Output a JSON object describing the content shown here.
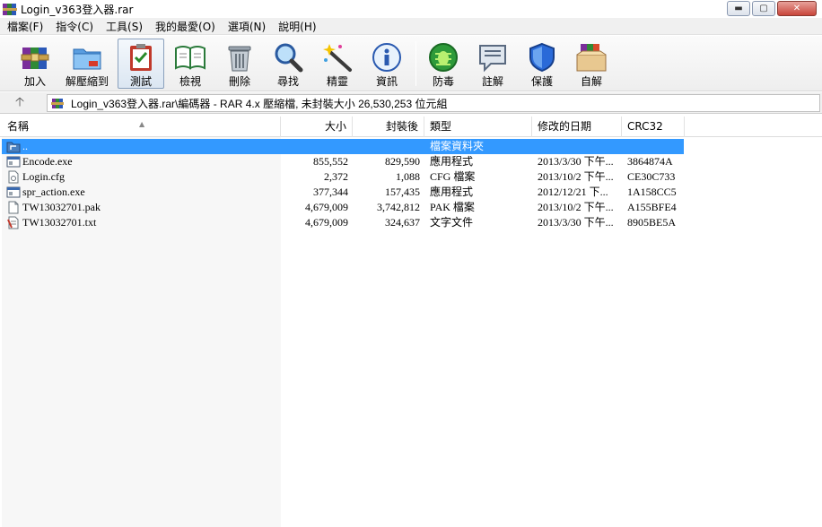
{
  "window": {
    "title": "Login_v363登入器.rar",
    "min_glyph": "▬",
    "max_glyph": "▢",
    "close_glyph": "✕"
  },
  "menu": [
    {
      "label": "檔案(F)"
    },
    {
      "label": "指令(C)"
    },
    {
      "label": "工具(S)"
    },
    {
      "label": "我的最愛(O)"
    },
    {
      "label": "選項(N)"
    },
    {
      "label": "說明(H)"
    }
  ],
  "toolbar": {
    "buttons": [
      {
        "label": "加入",
        "icon": "add-archive-icon"
      },
      {
        "label": "解壓縮到",
        "icon": "extract-folder-icon"
      },
      {
        "label": "測試",
        "icon": "test-clipboard-icon"
      },
      {
        "label": "檢視",
        "icon": "view-book-icon"
      },
      {
        "label": "刪除",
        "icon": "trash-icon"
      },
      {
        "label": "尋找",
        "icon": "magnifier-icon"
      },
      {
        "label": "精靈",
        "icon": "wizard-wand-icon"
      },
      {
        "label": "資訊",
        "icon": "info-icon"
      },
      {
        "label": "防毒",
        "icon": "antivirus-bug-icon"
      },
      {
        "label": "註解",
        "icon": "comment-icon"
      },
      {
        "label": "保護",
        "icon": "shield-icon"
      },
      {
        "label": "自解",
        "icon": "sfx-box-icon"
      }
    ]
  },
  "address": {
    "path": "Login_v363登入器.rar\\編碼器 - RAR 4.x 壓縮檔, 未封裝大小 26,530,253 位元組"
  },
  "columns": {
    "name": "名稱",
    "size": "大小",
    "packed": "封裝後",
    "type": "類型",
    "modified": "修改的日期",
    "crc": "CRC32"
  },
  "files": [
    {
      "name": "..",
      "size": "",
      "packed": "",
      "type": "檔案資料夾",
      "modified": "",
      "crc": "",
      "icon": "folder-up-icon",
      "selected": true
    },
    {
      "name": "Encode.exe",
      "size": "855,552",
      "packed": "829,590",
      "type": "應用程式",
      "modified": "2013/3/30 下午...",
      "crc": "3864874A",
      "icon": "exe-icon",
      "selected": false
    },
    {
      "name": "Login.cfg",
      "size": "2,372",
      "packed": "1,088",
      "type": "CFG 檔案",
      "modified": "2013/10/2 下午...",
      "crc": "CE30C733",
      "icon": "cfg-file-icon",
      "selected": false
    },
    {
      "name": "spr_action.exe",
      "size": "377,344",
      "packed": "157,435",
      "type": "應用程式",
      "modified": "2012/12/21 下...",
      "crc": "1A158CC5",
      "icon": "exe-icon",
      "selected": false
    },
    {
      "name": "TW13032701.pak",
      "size": "4,679,009",
      "packed": "3,742,812",
      "type": "PAK 檔案",
      "modified": "2013/10/2 下午...",
      "crc": "A155BFE4",
      "icon": "pak-file-icon",
      "selected": false
    },
    {
      "name": "TW13032701.txt",
      "size": "4,679,009",
      "packed": "324,637",
      "type": "文字文件",
      "modified": "2013/3/30 下午...",
      "crc": "8905BE5A",
      "icon": "txt-file-icon",
      "selected": false
    }
  ]
}
